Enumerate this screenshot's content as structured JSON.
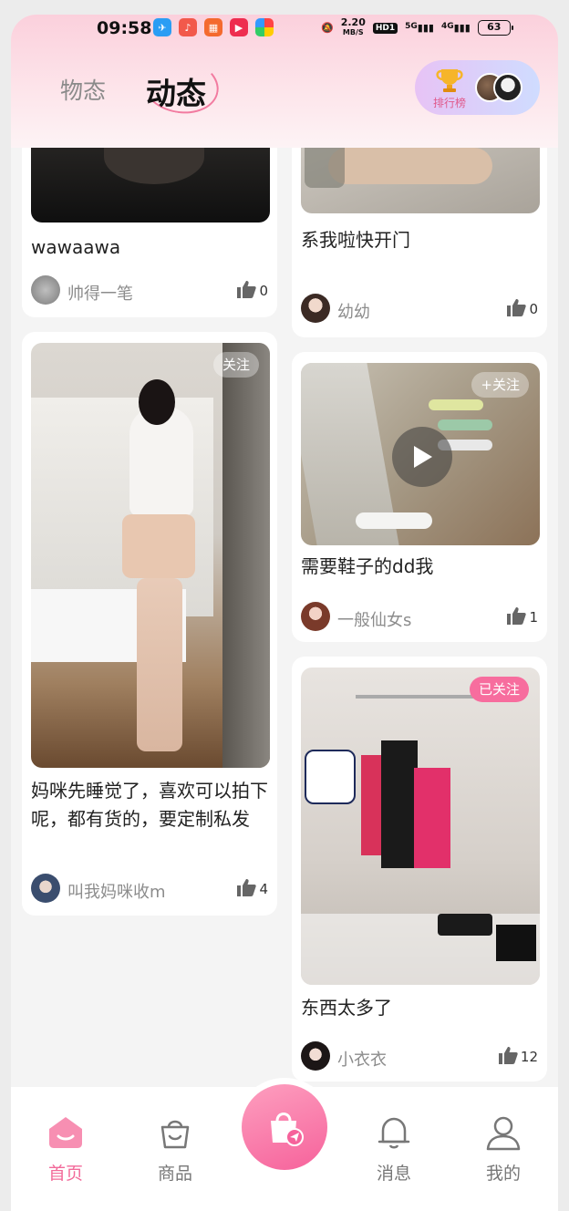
{
  "status_bar": {
    "time": "09:58",
    "net_speed_value": "2.20",
    "net_speed_unit": "MB/S",
    "hd_label": "HD1",
    "sim1_label": "5G",
    "sim2_label": "4G",
    "battery": "63"
  },
  "header": {
    "tabs": [
      {
        "label": "物态"
      },
      {
        "label": "动态"
      }
    ],
    "ranking_label": "排行榜"
  },
  "posts": [
    {
      "caption": "wawaawa",
      "author": "帅得一笔",
      "likes": "0"
    },
    {
      "caption": "系我啦快开门",
      "author": "幼幼",
      "likes": "0"
    },
    {
      "follow": "关注",
      "caption": "妈咪先睡觉了，喜欢可以拍下呢，都有货的，要定制私发",
      "author": "叫我妈咪收m",
      "likes": "4"
    },
    {
      "follow": "+关注",
      "caption": "需要鞋子的dd我",
      "author": "一般仙女s",
      "likes": "1"
    },
    {
      "follow": "已关注",
      "caption": "东西太多了",
      "author": "小衣衣",
      "likes": "12"
    }
  ],
  "bottom_nav": [
    {
      "label": "首页"
    },
    {
      "label": "商品"
    },
    {
      "label": "消息"
    },
    {
      "label": "我的"
    }
  ],
  "colors": {
    "accent": "#f26a9a",
    "followed_badge": "#f76d9e"
  }
}
